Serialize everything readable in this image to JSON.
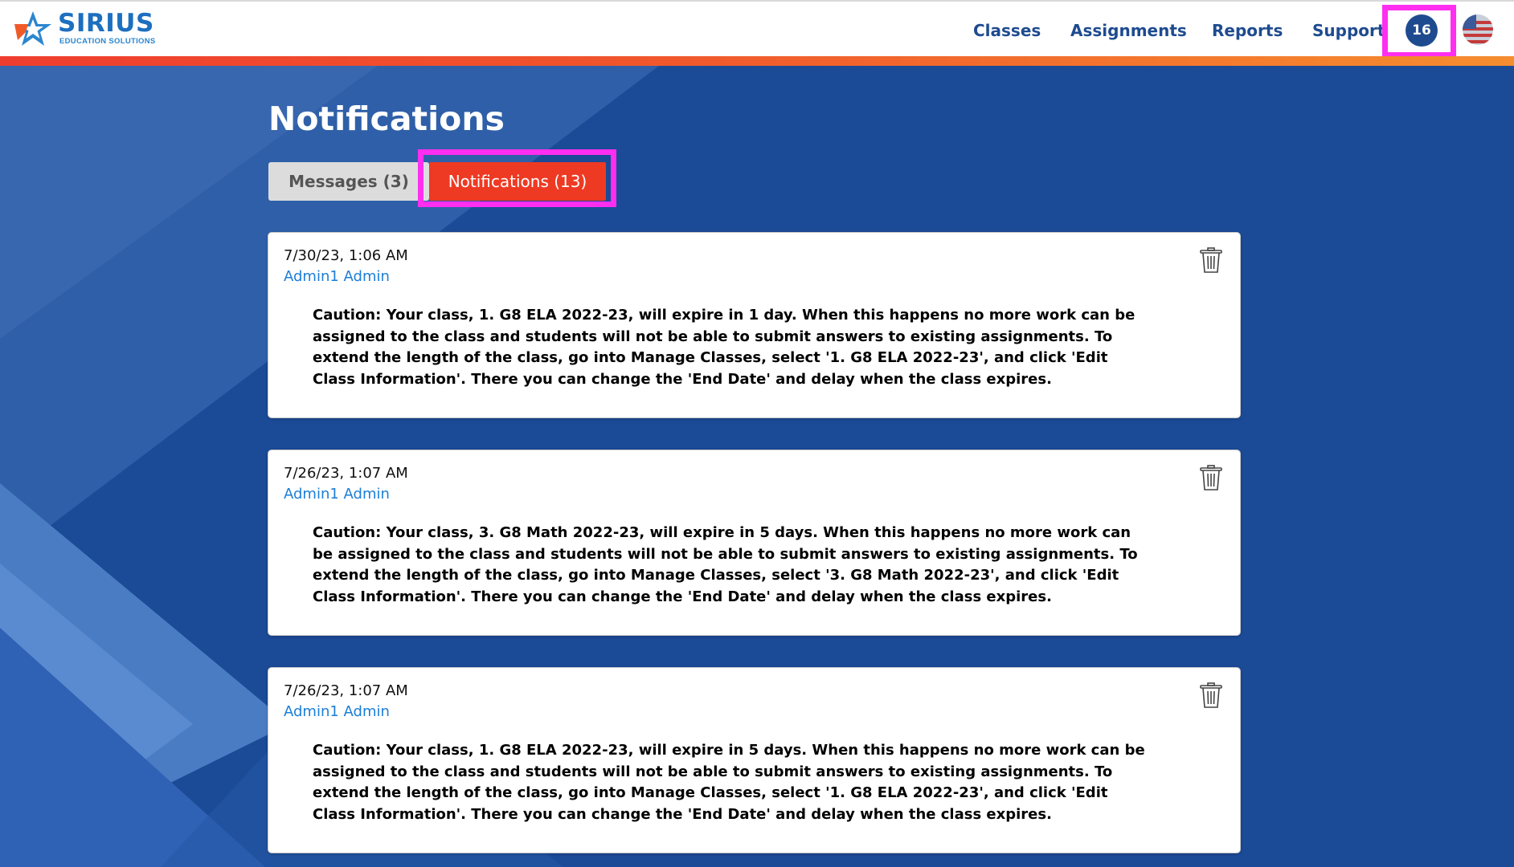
{
  "header": {
    "logo_text": "SIRIUS",
    "logo_subtext": "EDUCATION SOLUTIONS",
    "nav": {
      "classes": "Classes",
      "assignments": "Assignments",
      "reports": "Reports",
      "support": "Support"
    },
    "notification_count": "16",
    "icons": {
      "logo": "star-logo-icon",
      "avatar": "user-avatar-flag-icon"
    },
    "colors": {
      "nav_text": "#1e4b8f",
      "stripe_start": "#ef3e2f",
      "stripe_end": "#f58d2f",
      "badge_bg": "#1e4b8f",
      "highlight": "#ff2ef0"
    }
  },
  "page": {
    "title": "Notifications",
    "background": "#1b4a96"
  },
  "tabs": {
    "messages": "Messages (3)",
    "notifications": "Notifications (13)",
    "active": "notifications",
    "active_color": "#ee3a23"
  },
  "notifications": [
    {
      "date": "7/30/23, 1:06 AM",
      "sender": "Admin1 Admin",
      "message": "Caution: Your class, 1. G8 ELA 2022-23, will expire in 1 day. When this happens no more work can be assigned to the class and students will not be able to submit answers to existing assignments. To extend the length of the class, go into Manage Classes, select '1. G8 ELA 2022-23', and click 'Edit Class Information'. There you can change the 'End Date' and delay when the class expires.",
      "delete_icon": "trash-icon"
    },
    {
      "date": "7/26/23, 1:07 AM",
      "sender": "Admin1 Admin",
      "message": "Caution: Your class, 3. G8 Math 2022-23, will expire in 5 days. When this happens no more work can be assigned to the class and students will not be able to submit answers to existing assignments. To extend the length of the class, go into Manage Classes, select '3. G8 Math 2022-23', and click 'Edit Class Information'. There you can change the 'End Date' and delay when the class expires.",
      "delete_icon": "trash-icon"
    },
    {
      "date": "7/26/23, 1:07 AM",
      "sender": "Admin1 Admin",
      "message": "Caution: Your class, 1. G8 ELA 2022-23, will expire in 5 days. When this happens no more work can be assigned to the class and students will not be able to submit answers to existing assignments. To extend the length of the class, go into Manage Classes, select '1. G8 ELA 2022-23', and click 'Edit Class Information'. There you can change the 'End Date' and delay when the class expires.",
      "delete_icon": "trash-icon"
    }
  ]
}
